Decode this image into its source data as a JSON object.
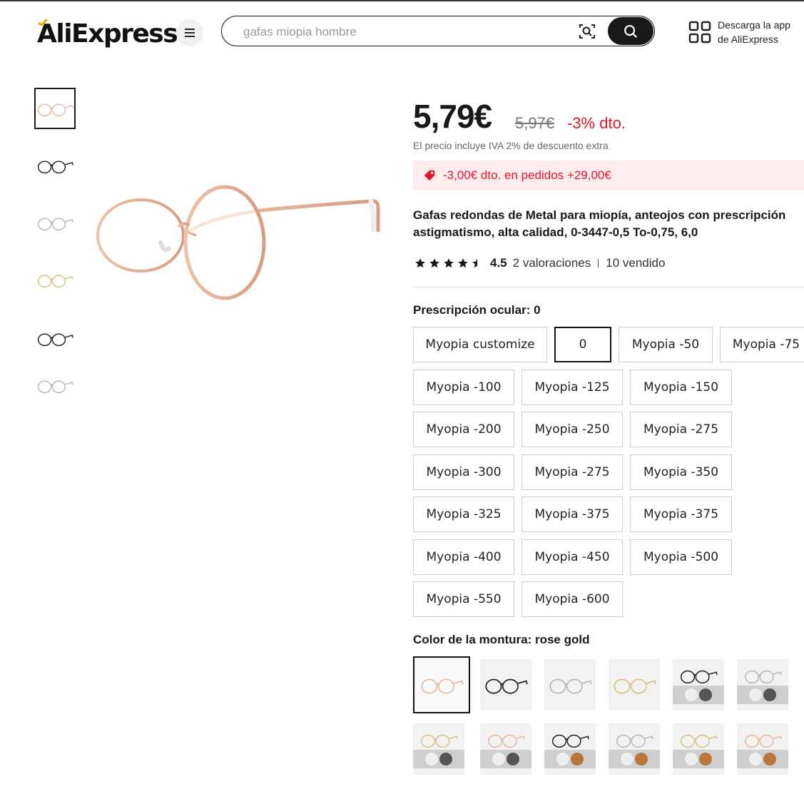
{
  "header": {
    "logo_text": "AliExpress",
    "search_placeholder": "gafas miopia hombre",
    "app_line1": "Descarga la app",
    "app_line2": "de AliExpress"
  },
  "product": {
    "price": "5,79€",
    "old_price": "5,97€",
    "discount": "-3% dto.",
    "vat_note": "El precio incluye IVA 2% de descuento extra",
    "coupon": "-3,00€ dto. en pedidos +29,00€",
    "title_line1": "Gafas redondas de Metal para miopía, anteojos con prescripción",
    "title_line2": "astigmatismo, alta calidad, 0-3447-0,5 To-0,75, 6,0",
    "rating": 4.5,
    "rating_text": "4.5",
    "reviews": "2 valoraciones",
    "sold": "10 vendido"
  },
  "prescription": {
    "label": "Prescripción ocular: 0",
    "options": [
      "Myopia customize",
      "0",
      "Myopia -50",
      "Myopia -75",
      "Myopia -100",
      "Myopia -125",
      "Myopia -150",
      "Myopia -200",
      "Myopia -250",
      "Myopia -275",
      "Myopia -300",
      "Myopia -275",
      "Myopia -350",
      "Myopia -325",
      "Myopia -375",
      "Myopia -375",
      "Myopia -400",
      "Myopia -450",
      "Myopia -500",
      "Myopia -550",
      "Myopia -600"
    ],
    "selected": "0"
  },
  "frame_color": {
    "label": "Color de la montura: rose gold",
    "swatches": [
      {
        "frame": "#e8b99e",
        "lens": "none"
      },
      {
        "frame": "#222222",
        "lens": "none"
      },
      {
        "frame": "#b8b8b8",
        "lens": "none"
      },
      {
        "frame": "#d9c08a",
        "lens": "none"
      },
      {
        "frame": "#222222",
        "lens": "Photochromic Grey"
      },
      {
        "frame": "#b8b8b8",
        "lens": "Photochromic Grey"
      },
      {
        "frame": "#d9c08a",
        "lens": "Photochromic Grey"
      },
      {
        "frame": "#e8b99e",
        "lens": "Photochromic Grey"
      },
      {
        "frame": "#222222",
        "lens": "Photochromic Brown"
      },
      {
        "frame": "#b8b8b8",
        "lens": "Photochromic Brown"
      },
      {
        "frame": "#d9c08a",
        "lens": "Photochromic Brown"
      },
      {
        "frame": "#e8b99e",
        "lens": "Photochromic Brown"
      }
    ]
  },
  "gallery": {
    "thumb_frames": [
      "#e8b99e",
      "#222222",
      "#b8b8b8",
      "#d9c08a",
      "#222222",
      "#b8b8b8"
    ]
  },
  "colors": {
    "accent_red": "#e4172d",
    "coupon_bg": "#ffeded",
    "dark": "#191919"
  }
}
